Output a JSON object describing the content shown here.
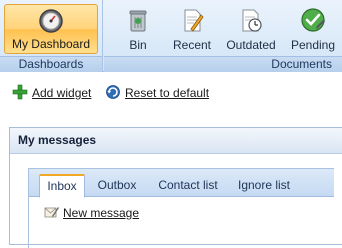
{
  "ribbon": {
    "dashboards": {
      "group_label": "Dashboards",
      "my_dashboard_label": "My Dashboard"
    },
    "documents": {
      "group_label": "Documents",
      "bin_label": "Bin",
      "recent_label": "Recent",
      "outdated_label": "Outdated",
      "pending_label": "Pending"
    }
  },
  "toolbar": {
    "add_widget": "Add widget",
    "reset_default": "Reset to default"
  },
  "messages": {
    "title": "My messages",
    "tabs": [
      {
        "label": "Inbox",
        "active": true
      },
      {
        "label": "Outbox",
        "active": false
      },
      {
        "label": "Contact list",
        "active": false
      },
      {
        "label": "Ignore list",
        "active": false
      }
    ],
    "new_message": "New message"
  },
  "colors": {
    "accent_active": "#ffc14f",
    "ribbon_blue": "#d2e4f6",
    "tab_accent": "#f0a826"
  }
}
